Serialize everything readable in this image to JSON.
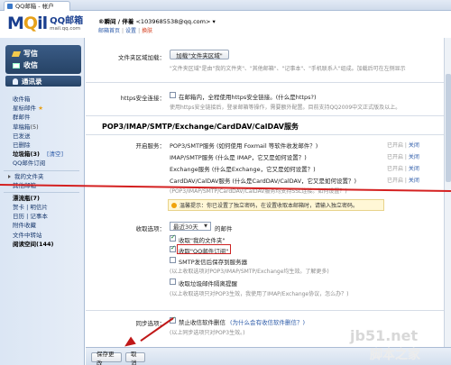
{
  "browser": {
    "tab_title": "QQ邮箱 - 帐户"
  },
  "header": {
    "logo_main": "MQil",
    "logo_cn": "QQ邮箱",
    "logo_url": "mail.qq.com",
    "user_nick": "®瞬间 / 伴着",
    "user_email": "<1039685538@qq.com>",
    "user_dropdown": "▾",
    "links": [
      "邮箱首页",
      "设置",
      "换肤"
    ]
  },
  "sidebar": {
    "compose": "写信",
    "receive": "收信",
    "contacts": "通讯录",
    "items": [
      {
        "label": "收件箱",
        "bold": false
      },
      {
        "label": "星标邮件",
        "star": "★"
      },
      {
        "label": "群邮件"
      },
      {
        "label": "草稿箱",
        "count": "(5)"
      },
      {
        "label": "已发送"
      },
      {
        "label": "已删除"
      },
      {
        "label": "垃圾箱",
        "count": "(3)",
        "clear": "[清空]",
        "bold": true
      },
      {
        "label": "QQ邮件订阅"
      }
    ],
    "folders": [
      {
        "label": "我的文件夹"
      },
      {
        "label": "其他邮箱"
      }
    ],
    "apps": [
      {
        "label": "漂流瓶",
        "count": "(7)",
        "bold": true
      },
      {
        "label": "贺卡 | 明信片"
      },
      {
        "label": "日历 | 记事本"
      },
      {
        "label": "附件收藏"
      },
      {
        "label": "文件中转站"
      },
      {
        "label": "阅读空间",
        "count": "(144)",
        "bold": true
      }
    ]
  },
  "settings": {
    "folder_add_label": "文件夹区域加载：",
    "folder_add_button": "加载\"文件夹区域\"",
    "folder_add_note": "\"文件夹区域\"是由\"我的文件夹\"、\"其他邮箱\"、\"记事本\"、\"手机联系人\"组成。加载后可在左侧显示",
    "https_label": "https安全连接：",
    "https_checkbox": "在邮箱内，全程使用https安全链接。(什么是https?)",
    "https_note": "使用https安全链接后，登录邮箱等操作，需要额外配置。目前支持QQ2009中文正式版及以上。",
    "section_title": "POP3/IMAP/SMTP/Exchange/CardDAV/CalDAV服务",
    "open_service_label": "开启服务：",
    "services": [
      {
        "text": "POP3/SMTP服务 (如何使用 Foxmail 等软件收发邮件？)",
        "status": "已开启",
        "action": "关闭"
      },
      {
        "text": "IMAP/SMTP服务 (什么是 IMAP，它又是如何设置？)",
        "status": "已开启",
        "action": "关闭"
      },
      {
        "text": "Exchange服务 (什么是Exchange，它又是如何设置？)",
        "status": "已开启",
        "action": "关闭"
      },
      {
        "text": "CardDAV/CalDAV服务 (什么是CardDAV/CalDAV，它又是如何设置？)",
        "status": "已开启",
        "action": "关闭"
      }
    ],
    "ssl_note": "(POP3/IMAP/SMTP/CardDAV/CalDAV服务均支持SSL连接。如何设置？)",
    "tip": "温馨提示：你已设置了独立密码，在设置收取本邮箱时，请输入独立密码。",
    "receive_label": "收取选项：",
    "receive_select": "最近30天",
    "receive_suffix": "的邮件",
    "receive_opt1": "收取\"我的文件夹\"",
    "receive_opt2": "收取\"QQ邮件订阅\"",
    "receive_opt3": "SMTP发信后保存到服务器",
    "receive_opt3_note": "(以上收取选项对POP3/IMAP/SMTP/Exchange均生效。了解更多)",
    "receive_opt4": "收取垃圾邮件隔离提醒",
    "receive_opt4_note": "(以上收取选项只对POP3生效，我使用了IMAP/Exchange协议，怎么办？)",
    "sync_label": "同步选项：",
    "sync_checkbox": "禁止收信软件删信",
    "sync_link": "(为什么会有收信软件删信？)",
    "sync_note": "(以上同步选项只对POP3生效。)",
    "save_button": "保存更改",
    "cancel_button": "取消"
  },
  "watermark": {
    "line1": "jb51.net",
    "line2": "脚本之家"
  },
  "colors": {
    "accent": "#2b5aa8",
    "annotation": "#d42020",
    "sidebar_dark": "#264366"
  }
}
